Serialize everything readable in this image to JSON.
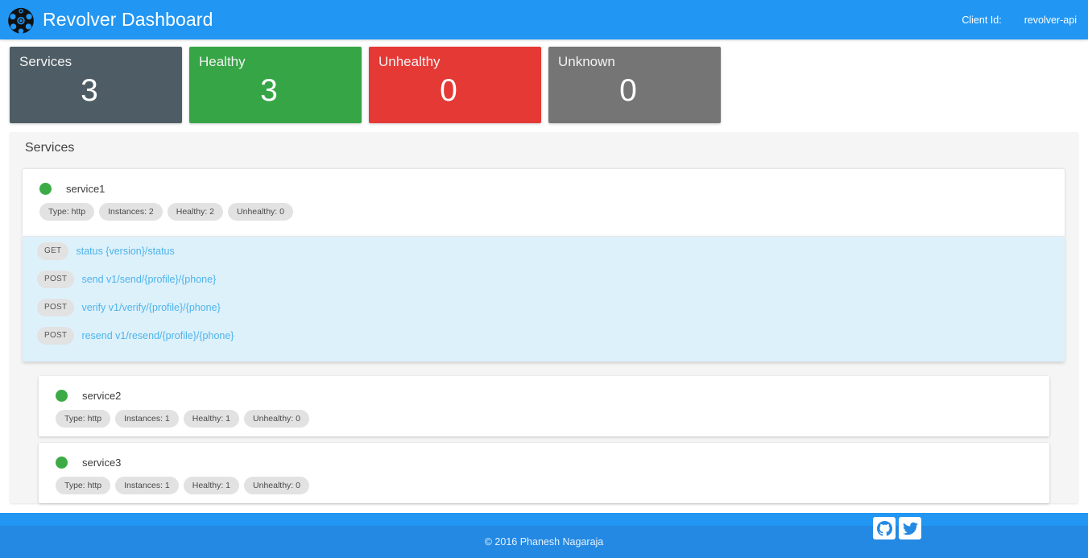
{
  "header": {
    "brand_title": "Revolver Dashboard",
    "logo_icon": "revolver-cylinder-icon",
    "client_id_label": "Client Id:",
    "client_id_value": "revolver-api",
    "background_color": "#2196f3"
  },
  "stats": [
    {
      "title": "Services",
      "value": "3",
      "color": "#4e5d65"
    },
    {
      "title": "Healthy",
      "value": "3",
      "color": "#36a546"
    },
    {
      "title": "Unhealthy",
      "value": "0",
      "color": "#e53935"
    },
    {
      "title": "Unknown",
      "value": "0",
      "color": "#757575"
    }
  ],
  "panel": {
    "title": "Services"
  },
  "services": [
    {
      "name": "service1",
      "status": "healthy",
      "status_color": "#3dab45",
      "badges": [
        "Type: http",
        "Instances: 2",
        "Healthy: 2",
        "Unhealthy: 0"
      ],
      "expanded": true,
      "endpoints": [
        {
          "method": "GET",
          "path": "status {version}/status"
        },
        {
          "method": "POST",
          "path": "send v1/send/{profile}/{phone}"
        },
        {
          "method": "POST",
          "path": "verify v1/verify/{profile}/{phone}"
        },
        {
          "method": "POST",
          "path": "resend v1/resend/{profile}/{phone}"
        }
      ]
    },
    {
      "name": "service2",
      "status": "healthy",
      "status_color": "#3dab45",
      "badges": [
        "Type: http",
        "Instances: 1",
        "Healthy: 1",
        "Unhealthy: 0"
      ],
      "expanded": false,
      "endpoints": []
    },
    {
      "name": "service3",
      "status": "healthy",
      "status_color": "#3dab45",
      "badges": [
        "Type: http",
        "Instances: 1",
        "Healthy: 1",
        "Unhealthy: 0"
      ],
      "expanded": false,
      "endpoints": []
    }
  ],
  "footer": {
    "copyright": "© 2016 Phanesh Nagaraja",
    "social": [
      {
        "icon": "github-icon"
      },
      {
        "icon": "twitter-icon"
      }
    ],
    "background_color": "#2489e2"
  }
}
